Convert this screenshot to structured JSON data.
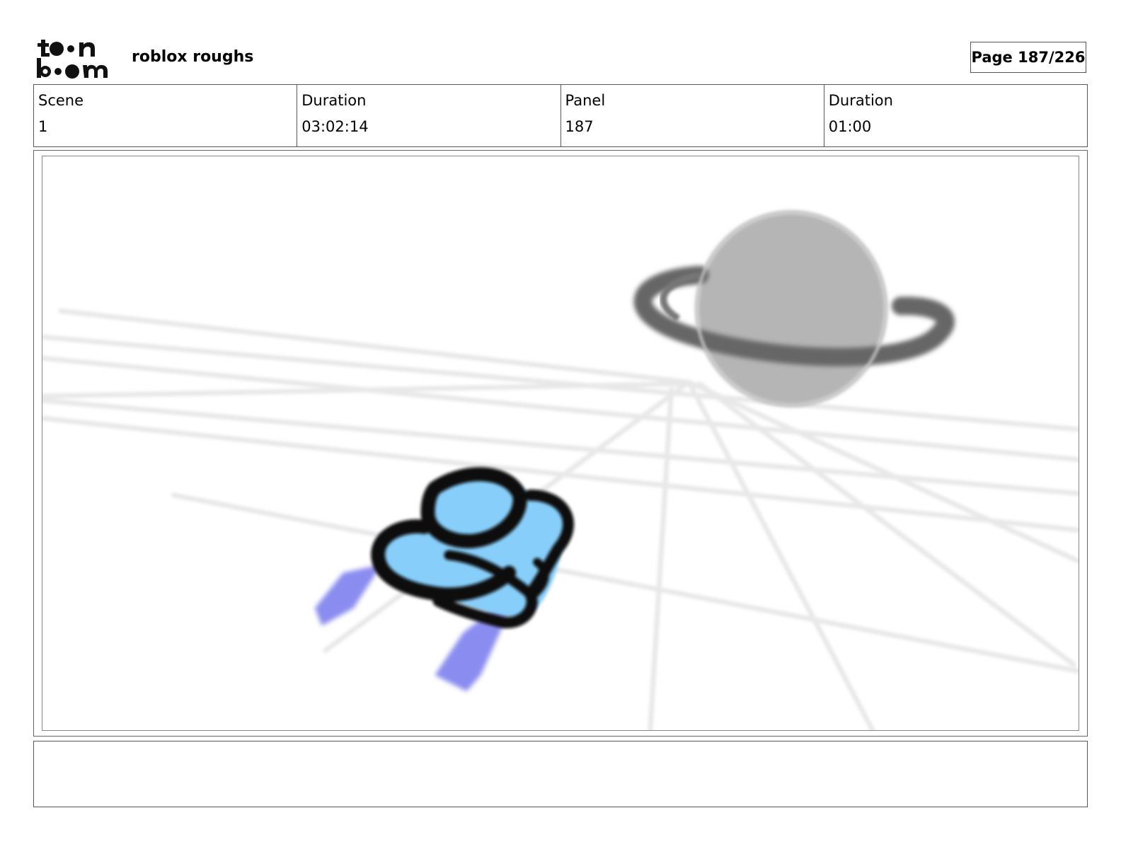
{
  "header": {
    "logo_text_line1": "toon",
    "logo_text_line2": "boom",
    "project_title": "roblox roughs",
    "page_label": "Page 187/226"
  },
  "info": {
    "scene_label": "Scene",
    "scene_value": "1",
    "scene_duration_label": "Duration",
    "scene_duration_value": "03:02:14",
    "panel_label": "Panel",
    "panel_value": "187",
    "panel_duration_label": "Duration",
    "panel_duration_value": "01:00"
  },
  "panel_art": {
    "icons": [
      "planet-icon",
      "spaceship-icon",
      "perspective-grid"
    ],
    "colors": {
      "planet": "#b5b5b5",
      "ring": "#666666",
      "ship_outline": "#111111",
      "ship_body": "#87cefa",
      "thruster": "#8a8cf0",
      "grid_lines": "#e8e8e8"
    }
  },
  "notes": {
    "text": ""
  }
}
